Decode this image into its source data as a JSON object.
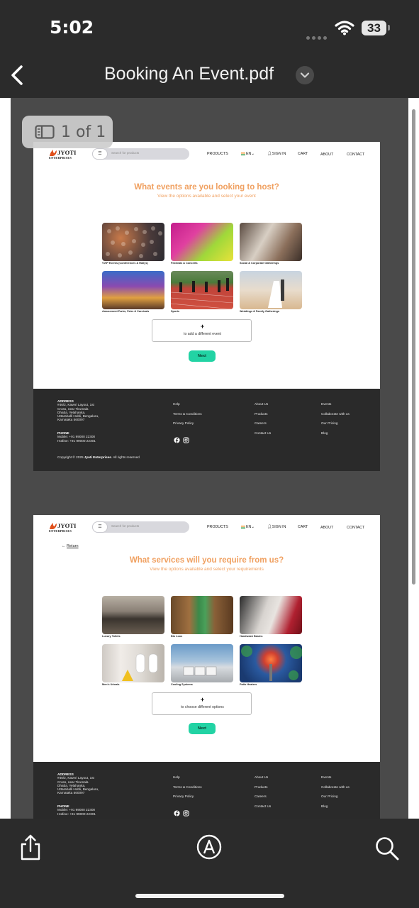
{
  "status": {
    "time": "5:02",
    "battery": "33"
  },
  "navbar": {
    "title": "Booking An Event.pdf"
  },
  "viewer": {
    "page_indicator": "1 of 1"
  },
  "site": {
    "logo": "JYOTI",
    "logo_sub": "ENTERPRISES",
    "search_placeholder": "Search for products",
    "nav": {
      "products": "PRODUCTS",
      "lang": "EN",
      "sign_in": "SIGN IN",
      "cart": "CART",
      "about": "ABOUT",
      "contact": "CONTACT"
    }
  },
  "page1": {
    "title": "What events are you looking to host?",
    "subtitle": "View the options available and select your event",
    "cards": [
      "VVIP Events (Conferences & Rallys)",
      "Festivals & Concerts",
      "Social & Corporate Gatherings",
      "Amusement Parks, Fairs & Carnivals",
      "Sports",
      "Weddings & Family Gatherings"
    ],
    "add_plus": "+",
    "add_text": "to add a different event",
    "next": "Next"
  },
  "page2": {
    "return": "Return",
    "title": "What services will you require from us?",
    "subtitle": "View the options available and select your requirements",
    "cards": [
      "Luxury Toilets",
      "Bio Loos",
      "Handwash Basins",
      "Men's Urinals",
      "Cooling Systems",
      "Patio Heaters"
    ],
    "add_plus": "+",
    "add_text": "to choose different options",
    "next": "Next"
  },
  "footer": {
    "address_label": "ADDRESS",
    "address_lines": [
      "#46/2, Kaveri Layout, 1st",
      "Cross, near Tirumala",
      "Dhaba, Yelahanka,",
      "Uttarahalli Hobli, Bengaluru,",
      "Karnataka 560097"
    ],
    "phone_label": "PHONE",
    "phone_lines": [
      "Mobile: +91 99000 22300",
      "Hotline: +91 99000 22301"
    ],
    "col2": [
      "Help",
      "Terms & Conditions",
      "Privacy Policy"
    ],
    "col3": [
      "About Us",
      "Products",
      "Careers",
      "Contact Us"
    ],
    "col4": [
      "Events",
      "Collaborate with us",
      "Our Pricing",
      "Blog"
    ],
    "copyright_prefix": "Copyright © 2025",
    "copyright_company": "Jyoti Enterprises",
    "copyright_suffix": ". All rights reserved"
  },
  "colors": {
    "accent_orange": "#f0a060",
    "next_green": "#22d3a4",
    "footer_bg": "#2a2a2a",
    "chrome_bg": "#2b2b2b"
  },
  "icons": [
    "back-chevron-icon",
    "chevron-down-icon",
    "wifi-icon",
    "battery-icon",
    "sidebar-icon",
    "share-icon",
    "markup-icon",
    "search-icon",
    "facebook-icon",
    "instagram-icon",
    "user-icon",
    "flag-icon",
    "return-arrow-icon",
    "menu-icon"
  ]
}
